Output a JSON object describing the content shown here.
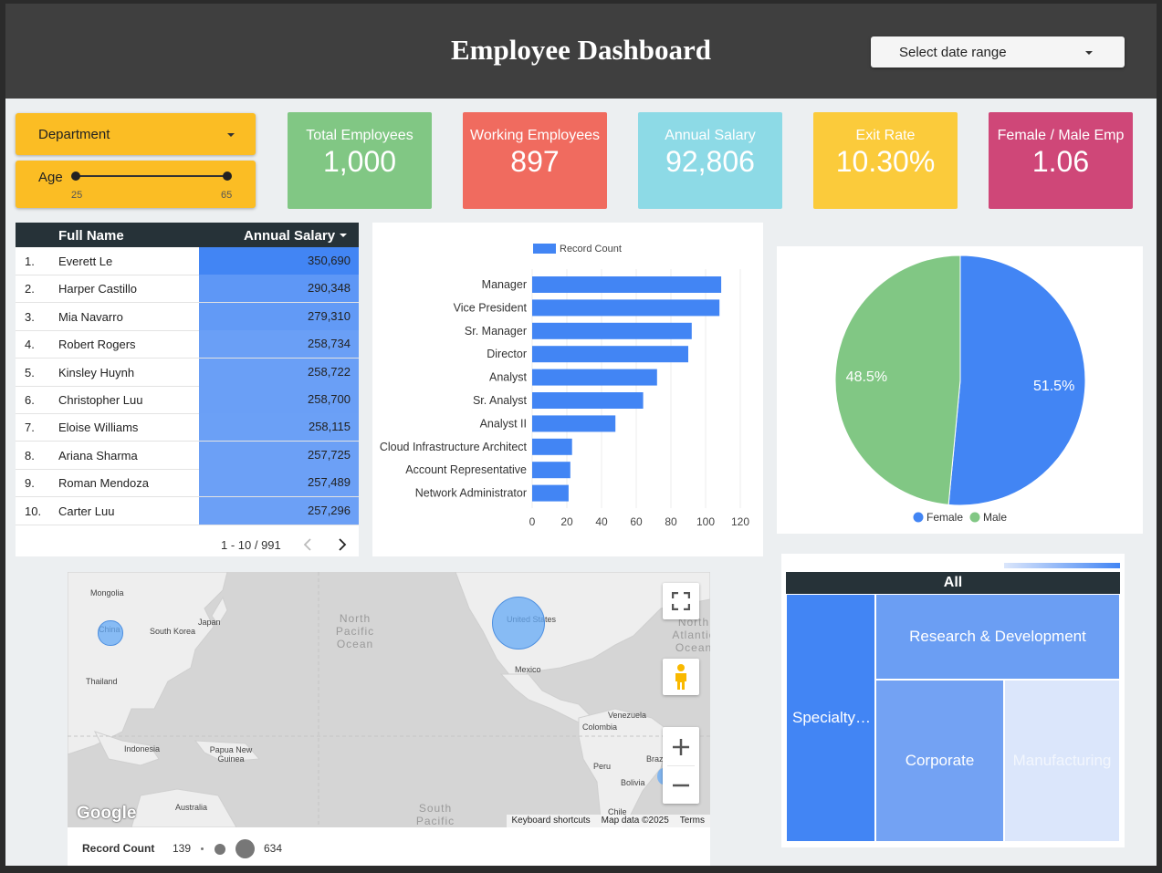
{
  "header": {
    "title": "Employee Dashboard",
    "date_select": "Select date range"
  },
  "filters": {
    "department": "Department",
    "age_label": "Age",
    "age_min": "25",
    "age_max": "65"
  },
  "kpis": [
    {
      "label": "Total Employees",
      "value": "1,000",
      "color": "#81c784"
    },
    {
      "label": "Working Employees",
      "value": "897",
      "color": "#f06b5f"
    },
    {
      "label": "Annual Salary",
      "value": "92,806",
      "color": "#8ddae6"
    },
    {
      "label": "Exit Rate",
      "value": "10.30%",
      "color": "#fbcb3b"
    },
    {
      "label": "Female / Male Emp",
      "value": "1.06",
      "color": "#cf4778"
    }
  ],
  "table": {
    "col_name": "Full Name",
    "col_salary": "Annual Salary",
    "rows": [
      {
        "num": "1.",
        "name": "Everett Le",
        "salary": "350,690"
      },
      {
        "num": "2.",
        "name": "Harper Castillo",
        "salary": "290,348"
      },
      {
        "num": "3.",
        "name": "Mia Navarro",
        "salary": "279,310"
      },
      {
        "num": "4.",
        "name": "Robert Rogers",
        "salary": "258,734"
      },
      {
        "num": "5.",
        "name": "Kinsley Huynh",
        "salary": "258,722"
      },
      {
        "num": "6.",
        "name": "Christopher Luu",
        "salary": "258,700"
      },
      {
        "num": "7.",
        "name": "Eloise Williams",
        "salary": "258,115"
      },
      {
        "num": "8.",
        "name": "Ariana Sharma",
        "salary": "257,725"
      },
      {
        "num": "9.",
        "name": "Roman Mendoza",
        "salary": "257,489"
      },
      {
        "num": "10.",
        "name": "Carter Luu",
        "salary": "257,296"
      }
    ],
    "pager": "1 - 10 / 991"
  },
  "chart_data": [
    {
      "type": "bar",
      "orientation": "horizontal",
      "categories": [
        "Manager",
        "Vice President",
        "Sr. Manager",
        "Director",
        "Analyst",
        "Sr. Analyst",
        "Analyst II",
        "Cloud Infrastructure Architect",
        "Account Representative",
        "Network Administrator"
      ],
      "series": [
        {
          "name": "Record Count",
          "values": [
            109,
            108,
            92,
            90,
            72,
            64,
            48,
            23,
            22,
            21
          ]
        }
      ],
      "xticks": [
        "0",
        "20",
        "40",
        "60",
        "80",
        "100",
        "120"
      ],
      "xlim": [
        0,
        120
      ],
      "grid": true,
      "legend": "top-left",
      "color": "#4285f4"
    },
    {
      "type": "pie",
      "labels": [
        "Female",
        "Male"
      ],
      "values": [
        51.5,
        48.5
      ],
      "value_labels": [
        "51.5%",
        "48.5%"
      ],
      "colors": [
        "#4285f4",
        "#81c784"
      ],
      "legend": "bottom"
    }
  ],
  "map": {
    "labels": [
      "Mongolia",
      "China",
      "South Korea",
      "Japan",
      "Thailand",
      "Indonesia",
      "Papua New Guinea",
      "Australia",
      "United States",
      "Mexico",
      "Venezuela",
      "Colombia",
      "Peru",
      "Bolivia",
      "Brazil",
      "Chile"
    ],
    "oceans": [
      "North Pacific Ocean",
      "North Atlantic Ocean",
      "South Pacific"
    ],
    "logo": "Google",
    "footer": [
      "Keyboard shortcuts",
      "Map data ©2025",
      "Terms"
    ],
    "legend_title": "Record Count",
    "legend_min": "139",
    "legend_max": "634",
    "bubbles": [
      {
        "name": "United States",
        "value": 634
      },
      {
        "name": "China",
        "value": 139
      }
    ]
  },
  "treemap": {
    "root": "All",
    "cells": [
      "Specialty…",
      "Research & Development",
      "Corporate",
      "Manufacturing"
    ]
  }
}
